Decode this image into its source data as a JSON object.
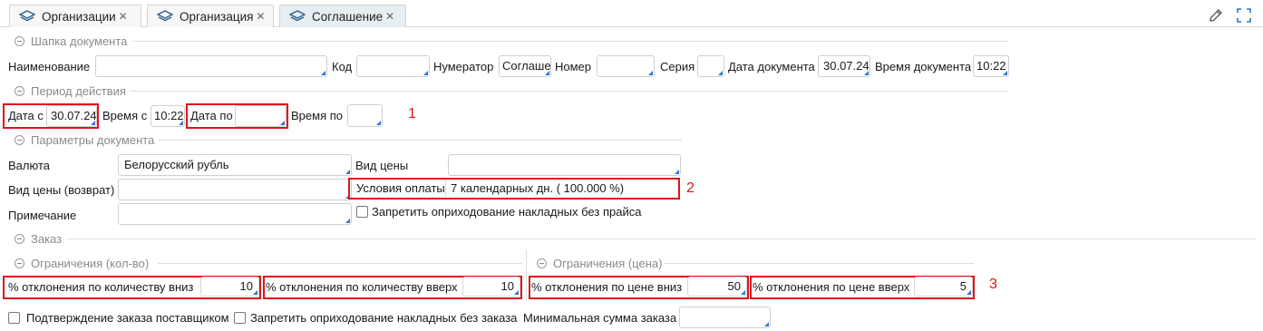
{
  "tabs": [
    {
      "label": "Организации",
      "icon": "layers-icon"
    },
    {
      "label": "Организация",
      "icon": "layers-icon"
    },
    {
      "label": "Соглашение",
      "icon": "layers-icon",
      "active": true
    }
  ],
  "toolbar": {
    "edit_icon": "pencil-icon",
    "fullscreen_icon": "expand-icon"
  },
  "header_group": {
    "title": "Шапка документа",
    "name_label": "Наименование",
    "name_value": "",
    "code_label": "Код",
    "code_value": "",
    "numerator_label": "Нумератор",
    "numerator_value": "Соглаше",
    "number_label": "Номер",
    "number_value": "",
    "series_label": "Серия",
    "series_value": "",
    "date_label": "Дата документа",
    "date_value": "30.07.24",
    "time_label": "Время документа",
    "time_value": "10:22"
  },
  "period_group": {
    "title": "Период действия",
    "date_from_label": "Дата с",
    "date_from_value": "30.07.24",
    "time_from_label": "Время с",
    "time_from_value": "10:22",
    "date_to_label": "Дата по",
    "date_to_value": "",
    "time_to_label": "Время по",
    "time_to_value": ""
  },
  "params_group": {
    "title": "Параметры документа",
    "currency_label": "Валюта",
    "currency_value": "Белорусский рубль",
    "price_type_label": "Вид цены",
    "price_type_value": "",
    "return_price_label": "Вид цены (возврат)",
    "return_price_value": "",
    "payment_label": "Условия оплаты",
    "payment_value": "7 календарных дн. ( 100.000 %)",
    "note_label": "Примечание",
    "note_value": "",
    "forbid_no_price_label": "Запретить оприходование накладных без прайса",
    "forbid_no_price_checked": false
  },
  "order_group": {
    "title": "Заказ",
    "qty_limits_title": "Ограничения (кол-во)",
    "price_limits_title": "Ограничения (цена)",
    "qty_down_label": "% отклонения по количеству вниз",
    "qty_down_value": "10",
    "qty_up_label": "% отклонения по количеству вверх",
    "qty_up_value": "10",
    "price_down_label": "% отклонения по цене вниз",
    "price_down_value": "50",
    "price_up_label": "% отклонения по цене вверх",
    "price_up_value": "5",
    "supplier_confirm_label": "Подтверждение заказа поставщиком",
    "supplier_confirm_checked": false,
    "forbid_no_order_label": "Запретить оприходование накладных без заказа",
    "forbid_no_order_checked": false,
    "min_sum_label": "Минимальная сумма заказа",
    "min_sum_value": ""
  },
  "annotations": {
    "marker_1": "1",
    "marker_2": "2",
    "marker_3": "3",
    "color": "#e0121a"
  }
}
